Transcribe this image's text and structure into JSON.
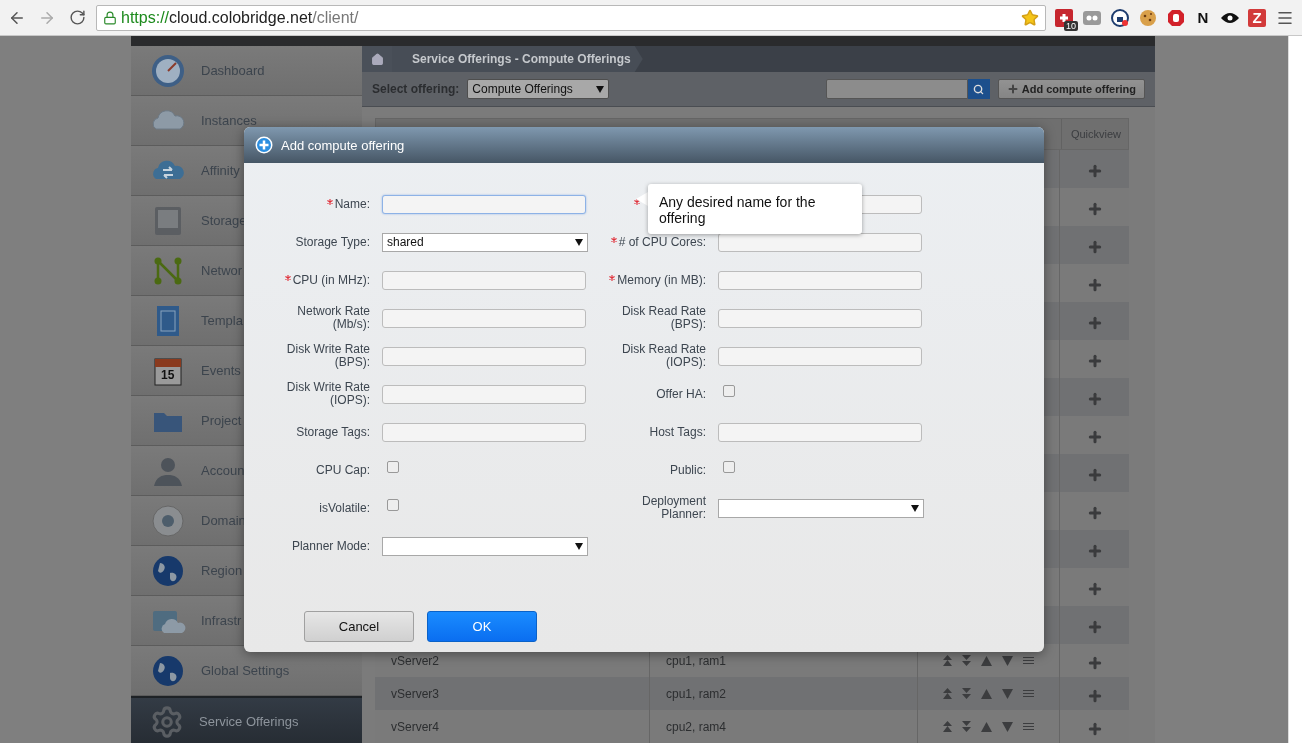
{
  "browser": {
    "url_scheme": "https://",
    "url_host": "cloud.colobridge.net",
    "url_path": "/client/",
    "extensions": [
      {
        "kind": "puzzle",
        "badge": "10"
      },
      {
        "kind": "ghost"
      },
      {
        "kind": "shield"
      },
      {
        "kind": "cookie"
      },
      {
        "kind": "stop"
      },
      {
        "kind": "letter",
        "text": "N"
      },
      {
        "kind": "eye"
      },
      {
        "kind": "tile",
        "text": "Z"
      }
    ]
  },
  "sidebar": {
    "items": [
      {
        "label": "Dashboard",
        "selected": false
      },
      {
        "label": "Instances",
        "selected": false
      },
      {
        "label": "Affinity",
        "selected": false
      },
      {
        "label": "Storage",
        "selected": false
      },
      {
        "label": "Networ",
        "selected": false
      },
      {
        "label": "Templa",
        "selected": false
      },
      {
        "label": "Events",
        "icon_text": "15",
        "selected": false
      },
      {
        "label": "Project",
        "selected": false
      },
      {
        "label": "Accoun",
        "selected": false
      },
      {
        "label": "Domain",
        "selected": false
      },
      {
        "label": "Region",
        "selected": false
      },
      {
        "label": "Infrastr",
        "selected": false
      },
      {
        "label": "Global Settings",
        "selected": false
      },
      {
        "label": "Service Offerings",
        "selected": true
      }
    ]
  },
  "breadcrumb": [
    "Service Offerings - Compute Offerings"
  ],
  "toolbar": {
    "select_label": "Select offering:",
    "select_value": "Compute Offerings",
    "add_button": "Add compute offering"
  },
  "table": {
    "columns": [
      "Quickview"
    ],
    "rows": [
      {
        "kind": "covered"
      },
      {
        "kind": "covered"
      },
      {
        "kind": "covered"
      },
      {
        "kind": "covered"
      },
      {
        "kind": "covered"
      },
      {
        "kind": "covered"
      },
      {
        "kind": "covered"
      },
      {
        "kind": "covered"
      },
      {
        "kind": "covered"
      },
      {
        "kind": "covered"
      },
      {
        "kind": "covered"
      },
      {
        "kind": "covered"
      },
      {
        "kind": "covered"
      },
      {
        "kind": "server",
        "name": "vServer2",
        "tags": "cpu1, ram1"
      },
      {
        "kind": "server",
        "name": "vServer3",
        "tags": "cpu1, ram2"
      },
      {
        "kind": "server",
        "name": "vServer4",
        "tags": "cpu2, ram4"
      }
    ]
  },
  "dialog": {
    "title": "Add compute offering",
    "tooltip": "Any desired name for the offering",
    "rows": [
      [
        {
          "kind": "text",
          "label": "Name:",
          "required": true,
          "focused": true
        },
        {
          "kind": "text",
          "required": true,
          "focused": false
        }
      ],
      [
        {
          "kind": "select",
          "label": "Storage Type:",
          "value": "shared"
        },
        {
          "kind": "text",
          "label": "# of CPU Cores:",
          "required": true,
          "focused": false
        }
      ],
      [
        {
          "kind": "text",
          "label": "CPU (in MHz):",
          "required": true,
          "focused": false
        },
        {
          "kind": "text",
          "label": "Memory (in MB):",
          "required": true,
          "focused": false
        }
      ],
      [
        {
          "kind": "text",
          "label": "Network Rate (Mb/s):",
          "focused": false
        },
        {
          "kind": "text",
          "label": "Disk Read Rate (BPS):",
          "focused": false
        }
      ],
      [
        {
          "kind": "text",
          "label": "Disk Write Rate (BPS):",
          "focused": false
        },
        {
          "kind": "text",
          "label": "Disk Read Rate (IOPS):",
          "focused": false
        }
      ],
      [
        {
          "kind": "text",
          "label": "Disk Write Rate (IOPS):",
          "focused": false
        },
        {
          "kind": "checkbox",
          "label": "Offer HA:",
          "checked": false
        }
      ],
      [
        {
          "kind": "text",
          "label": "Storage Tags:",
          "focused": false
        },
        {
          "kind": "text",
          "label": "Host Tags:",
          "focused": false
        }
      ],
      [
        {
          "kind": "checkbox",
          "label": "CPU Cap:",
          "checked": false
        },
        {
          "kind": "checkbox",
          "label": "Public:",
          "checked": false
        }
      ],
      [
        {
          "kind": "checkbox",
          "label": "isVolatile:",
          "checked": false
        },
        {
          "kind": "select",
          "label": "Deployment Planner:"
        }
      ],
      [
        {
          "kind": "select",
          "label": "Planner Mode:"
        }
      ]
    ],
    "buttons": [
      {
        "label": "Cancel",
        "primary": false
      },
      {
        "label": "OK",
        "primary": true
      }
    ]
  }
}
